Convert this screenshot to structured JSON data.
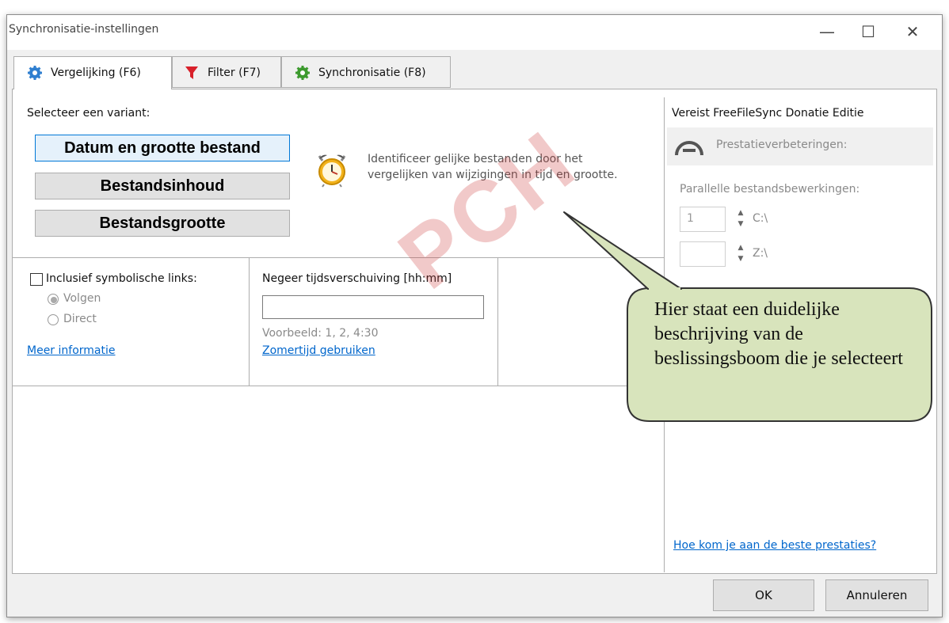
{
  "window": {
    "title": "Synchronisatie-instellingen"
  },
  "title_buttons": {
    "minimize": "—",
    "maximize": "☐",
    "close": "✕"
  },
  "tabs": [
    {
      "label": "Vergelijking (F6)",
      "icon": "gear-icon"
    },
    {
      "label": "Filter (F7)",
      "icon": "funnel-icon"
    },
    {
      "label": "Synchronisatie (F8)",
      "icon": "gear-green-icon"
    }
  ],
  "compare": {
    "select_label": "Selecteer een variant:",
    "variants": [
      "Datum en grootte bestand",
      "Bestandsinhoud",
      "Bestandsgrootte"
    ],
    "selected_index": 0,
    "description": "Identificeer gelijke bestanden door het vergelijken van wijzigingen in tijd en grootte."
  },
  "symlinks": {
    "checkbox_label": "Inclusief symbolische links:",
    "checked": false,
    "options": [
      "Volgen",
      "Direct"
    ],
    "more_info": "Meer informatie"
  },
  "timeshift": {
    "label": "Negeer tijdsverschuiving [hh:mm]",
    "value": "",
    "example": "Voorbeeld:  1, 2, 4:30",
    "dst_link": "Zomertijd gebruiken"
  },
  "side": {
    "header": "Vereist FreeFileSync Donatie Editie",
    "perf_title": "Prestatieverbeteringen:",
    "parallel_label": "Parallelle bestandsbewerkingen:",
    "rows": [
      {
        "value": "1",
        "drive": "C:\\"
      },
      {
        "value": "",
        "drive": "Z:\\"
      }
    ],
    "best_link": "Hoe kom je aan de beste prestaties?"
  },
  "footer": {
    "ok": "OK",
    "cancel": "Annuleren"
  },
  "watermark": "PCH",
  "callout": {
    "text": "Hier staat een duidelijke beschrijving van de beslissingsboom die je selecteert"
  },
  "colors": {
    "callout_fill": "#d8e4bc",
    "watermark": "#cd3c3c",
    "link": "#0066cc",
    "selected_border": "#0078d7"
  }
}
